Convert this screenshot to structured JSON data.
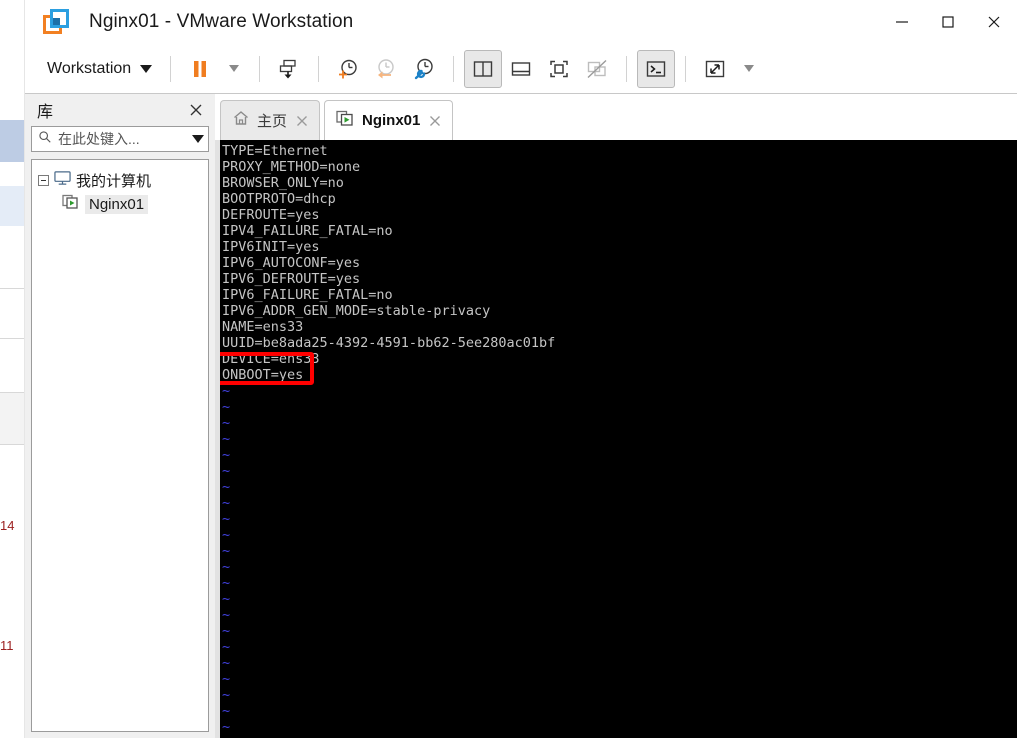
{
  "window": {
    "title": "Nginx01 - VMware Workstation",
    "logo_icon": "vmware-logo-icon",
    "controls": [
      {
        "name": "minimize-button",
        "icon": "minimize-icon"
      },
      {
        "name": "maximize-button",
        "icon": "maximize-icon"
      },
      {
        "name": "close-button",
        "icon": "close-icon"
      }
    ]
  },
  "toolbar": {
    "menu_label": "Workstation",
    "menu_caret_icon": "chevron-down-icon",
    "buttons": [
      {
        "name": "suspend-button",
        "icon": "pause-icon",
        "label": ""
      },
      {
        "name": "suspend-dropdown",
        "icon": "chevron-down-small-icon",
        "label": ""
      },
      {
        "name": "power-options-button",
        "icon": "vm-power-icon",
        "label": ""
      },
      {
        "name": "take-snapshot-button",
        "icon": "snapshot-add-icon",
        "label": ""
      },
      {
        "name": "revert-snapshot-button",
        "icon": "snapshot-revert-icon",
        "label": ""
      },
      {
        "name": "snapshot-manager-button",
        "icon": "snapshot-manager-icon",
        "label": ""
      },
      {
        "name": "show-library-button",
        "icon": "sidebar-panel-icon",
        "label": ""
      },
      {
        "name": "show-thumbnails-button",
        "icon": "thumbnail-bar-icon",
        "label": ""
      },
      {
        "name": "fullscreen-button",
        "icon": "fullscreen-icon",
        "label": ""
      },
      {
        "name": "unity-mode-button",
        "icon": "unity-mode-icon",
        "label": ""
      },
      {
        "name": "console-view-button",
        "icon": "console-prompt-icon",
        "label": ""
      },
      {
        "name": "stretch-guest-button",
        "icon": "stretch-arrows-icon",
        "label": ""
      },
      {
        "name": "stretch-dropdown",
        "icon": "chevron-down-small-icon",
        "label": ""
      }
    ]
  },
  "library": {
    "title": "库",
    "close_icon": "close-icon",
    "search": {
      "placeholder": "在此处键入...",
      "value": "",
      "search_icon": "search-icon",
      "dropdown_icon": "chevron-down-icon"
    },
    "tree": [
      {
        "label": "我的计算机",
        "icon": "computer-icon",
        "expanded": true,
        "selected": false
      },
      {
        "label": "Nginx01",
        "icon": "vm-running-icon",
        "expanded": false,
        "selected": true
      }
    ]
  },
  "tabs": [
    {
      "label": "主页",
      "icon": "home-icon",
      "active": false,
      "close_icon": "close-icon"
    },
    {
      "label": "Nginx01",
      "icon": "vm-running-icon",
      "active": true,
      "close_icon": "close-icon"
    }
  ],
  "terminal": {
    "lines": [
      "TYPE=Ethernet",
      "PROXY_METHOD=none",
      "BROWSER_ONLY=no",
      "BOOTPROTO=dhcp",
      "DEFROUTE=yes",
      "IPV4_FAILURE_FATAL=no",
      "IPV6INIT=yes",
      "IPV6_AUTOCONF=yes",
      "IPV6_DEFROUTE=yes",
      "IPV6_FAILURE_FATAL=no",
      "IPV6_ADDR_GEN_MODE=stable-privacy",
      "NAME=ens33",
      "UUID=be8ada25-4392-4591-bb62-5ee280ac01bf",
      "DEVICE=ens33",
      "ONBOOT=yes"
    ],
    "tilde_count": 22,
    "tilde_char": "~",
    "cursor_on_line": 14,
    "annotation": {
      "name": "onboot-highlight-box",
      "color": "#ff0000",
      "target_text": "ONBOOT=yes"
    },
    "colors": {
      "background": "#000000",
      "foreground": "#c5c5c5",
      "tilde": "#4141e0"
    }
  },
  "background_window": {
    "red_numbers": [
      "14",
      "11"
    ]
  }
}
